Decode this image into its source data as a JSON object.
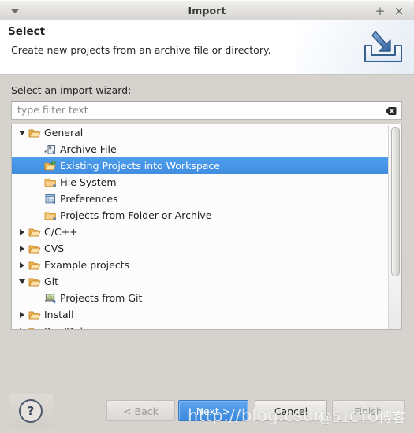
{
  "window": {
    "title": "Import",
    "menu_icon": "caret-down-icon",
    "maximize_label": "+",
    "close_label": "×"
  },
  "header": {
    "title": "Select",
    "subtitle": "Create new projects from an archive file or directory.",
    "icon": "import-arrow-icon"
  },
  "body": {
    "wizard_label": "Select an import wizard:",
    "filter": {
      "value": "",
      "placeholder": "type filter text",
      "clear_icon": "clear-text-icon"
    }
  },
  "tree": {
    "rows": [
      {
        "label": "General",
        "level": 0,
        "icon": "folder-open-icon",
        "twisty": "down",
        "selected": false
      },
      {
        "label": "Archive File",
        "level": 1,
        "icon": "archive-file-icon",
        "twisty": "none",
        "selected": false
      },
      {
        "label": "Existing Projects into Workspace",
        "level": 1,
        "icon": "import-project-icon",
        "twisty": "none",
        "selected": true
      },
      {
        "label": "File System",
        "level": 1,
        "icon": "folder-icon",
        "twisty": "none",
        "selected": false
      },
      {
        "label": "Preferences",
        "level": 1,
        "icon": "preferences-icon",
        "twisty": "none",
        "selected": false
      },
      {
        "label": "Projects from Folder or Archive",
        "level": 1,
        "icon": "folder-icon",
        "twisty": "none",
        "selected": false
      },
      {
        "label": "C/C++",
        "level": 0,
        "icon": "folder-open-icon",
        "twisty": "right",
        "selected": false
      },
      {
        "label": "CVS",
        "level": 0,
        "icon": "folder-open-icon",
        "twisty": "right",
        "selected": false
      },
      {
        "label": "Example projects",
        "level": 0,
        "icon": "folder-open-icon",
        "twisty": "right",
        "selected": false
      },
      {
        "label": "Git",
        "level": 0,
        "icon": "folder-open-icon",
        "twisty": "down",
        "selected": false
      },
      {
        "label": "Projects from Git",
        "level": 1,
        "icon": "git-projects-icon",
        "twisty": "none",
        "selected": false
      },
      {
        "label": "Install",
        "level": 0,
        "icon": "folder-open-icon",
        "twisty": "right",
        "selected": false
      },
      {
        "label": "Run/Debug",
        "level": 0,
        "icon": "folder-open-icon",
        "twisty": "right",
        "selected": false
      }
    ],
    "scrollbar": "vertical-scrollbar"
  },
  "footer": {
    "help_label": "?",
    "back_label": "< Back",
    "next_label": "Next >",
    "cancel_label": "Cancel",
    "finish_label": "Finish"
  },
  "watermarks": {
    "url": "http://blog.csdn",
    "site": "@51CTO博客"
  },
  "colors": {
    "selection": "#4a95e5",
    "primary_button": "#4a95e5",
    "dialog_bg": "#d6d2cd",
    "tree_bg": "#fcfcfc",
    "folder": "#e8a33d"
  }
}
